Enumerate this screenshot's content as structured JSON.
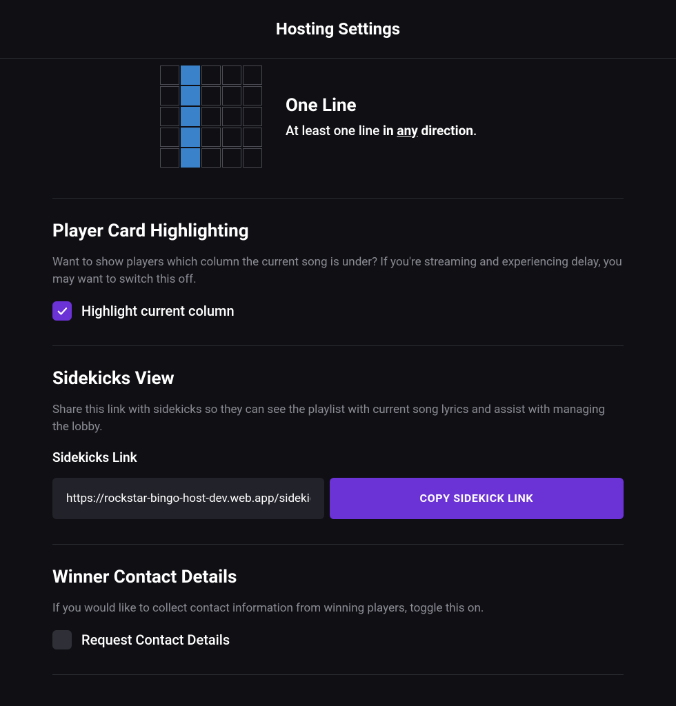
{
  "header": {
    "title": "Hosting Settings"
  },
  "pattern": {
    "title": "One Line",
    "desc_prefix": "At least one line ",
    "desc_bold": "in ",
    "desc_underline": "any",
    "desc_bold2": " direction",
    "desc_suffix": "."
  },
  "highlight": {
    "title": "Player Card Highlighting",
    "desc": "Want to show players which column the current song is under? If you're streaming and experiencing delay, you may want to switch this off.",
    "checkbox_label": "Highlight current column",
    "checked": true
  },
  "sidekicks": {
    "title": "Sidekicks View",
    "desc": "Share this link with sidekicks so they can see the playlist with current song lyrics and assist with managing the lobby.",
    "field_label": "Sidekicks Link",
    "link_value": "https://rockstar-bingo-host-dev.web.app/sidekick/",
    "copy_label": "COPY SIDEKICK LINK"
  },
  "winner": {
    "title": "Winner Contact Details",
    "desc": "If you would like to collect contact information from winning players, toggle this on.",
    "checkbox_label": "Request Contact Details",
    "checked": false
  },
  "grid_highlight_col": 1
}
